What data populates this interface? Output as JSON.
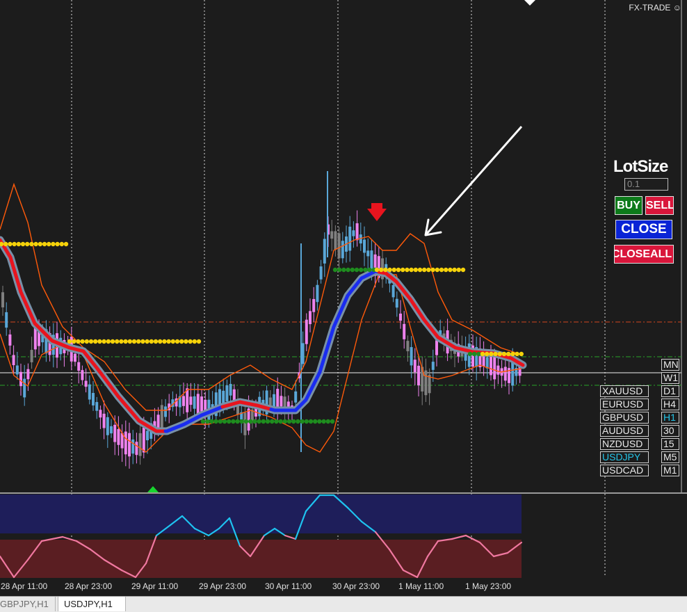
{
  "brand": "FX-TRADE",
  "brand_icon": "smiley-icon",
  "panel": {
    "title": "LotSize",
    "lot_value": "0.1",
    "buy_label": "BUY",
    "sell_label": "SELL",
    "close_label": "CLOSE",
    "closeall_label": "CLOSEALL"
  },
  "symbols": [
    {
      "label": "XAUUSD",
      "active": false
    },
    {
      "label": "EURUSD",
      "active": false
    },
    {
      "label": "GBPUSD",
      "active": false
    },
    {
      "label": "AUDUSD",
      "active": false
    },
    {
      "label": "NZDUSD",
      "active": false
    },
    {
      "label": "USDJPY",
      "active": true
    },
    {
      "label": "USDCAD",
      "active": false
    }
  ],
  "timeframes": [
    {
      "label": "MN",
      "active": false
    },
    {
      "label": "W1",
      "active": false
    },
    {
      "label": "D1",
      "active": false
    },
    {
      "label": "H4",
      "active": false
    },
    {
      "label": "H1",
      "active": true
    },
    {
      "label": "30",
      "active": false
    },
    {
      "label": "15",
      "active": false
    },
    {
      "label": "M5",
      "active": false
    },
    {
      "label": "M1",
      "active": false
    }
  ],
  "time_axis": [
    "28 Apr 11:00",
    "28 Apr 23:00",
    "29 Apr 11:00",
    "29 Apr 23:00",
    "30 Apr 11:00",
    "30 Apr 23:00",
    "1 May 11:00",
    "1 May 23:00"
  ],
  "tabs": [
    {
      "label": "GBPJPY,H1",
      "active": false
    },
    {
      "label": "USDJPY,H1",
      "active": true
    }
  ],
  "colors": {
    "background": "#1c1c1c",
    "bull_candle": "#5aa7d8",
    "bear_candle": "#ee82ee",
    "neutral_candle": "#808080",
    "ma_outer": "#7890a8",
    "ma_down": "#e8141e",
    "ma_up": "#1a2cf0",
    "envelope": "#ff5a0a",
    "level_yellow": "#f5d20a",
    "level_green": "#1e8c1e",
    "osc_top_zone": "#1e1e5a",
    "osc_bottom_zone": "#5a1e22",
    "osc_up": "#1ec3f0",
    "osc_down": "#f078a0",
    "buy": "#0d7a1a",
    "sell": "#d9163b",
    "close": "#0a24d6"
  }
}
